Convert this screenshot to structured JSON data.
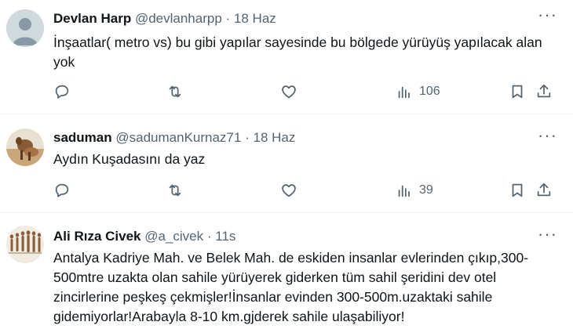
{
  "tweets": [
    {
      "name": "Devlan Harp",
      "handle": "@devlanharpp",
      "sep": "·",
      "date": "18 Haz",
      "text": "İnşaatlar( metro vs) bu gibi yapılar sayesinde bu bölgede yürüyüş yapılacak alan yok",
      "views": "106",
      "avatar": "default-avatar"
    },
    {
      "name": "saduman",
      "handle": "@sadumanKurnaz71",
      "sep": "·",
      "date": "18 Haz",
      "text": "Aydın Kuşadasını da yaz",
      "views": "39",
      "avatar": "photo-avatar"
    },
    {
      "name": "Ali Rıza Civek",
      "handle": "@a_civek",
      "sep": "·",
      "date": "11s",
      "text": "Antalya Kadriye Mah. ve Belek Mah. de eskiden insanlar evlerinden çıkıp,300-500mtre uzakta olan sahile yürüyerek giderken tüm sahil şeridini dev otel zincirlerine peşkeş çekmişler!İnsanlar evinden 300-500m.uzaktaki sahile gidemiyorlar!Arabayla 8-10 km.gjderek sahile ulaşabiliyor!",
      "avatar": "figures-avatar"
    }
  ],
  "more_glyph": "···",
  "colors": {
    "text": "#0f1419",
    "muted": "#536471",
    "divider": "#eff3f4"
  }
}
